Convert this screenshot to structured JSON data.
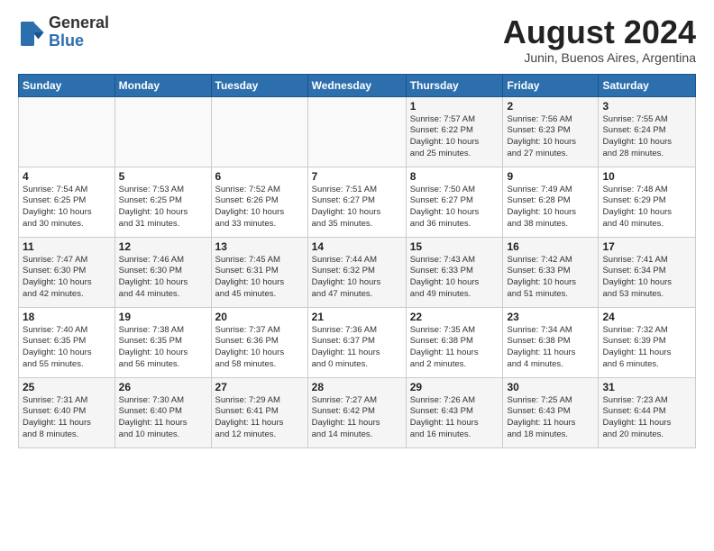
{
  "logo": {
    "line1": "General",
    "line2": "Blue"
  },
  "header": {
    "month_year": "August 2024",
    "location": "Junin, Buenos Aires, Argentina"
  },
  "days_of_week": [
    "Sunday",
    "Monday",
    "Tuesday",
    "Wednesday",
    "Thursday",
    "Friday",
    "Saturday"
  ],
  "weeks": [
    [
      {
        "day": "",
        "info": ""
      },
      {
        "day": "",
        "info": ""
      },
      {
        "day": "",
        "info": ""
      },
      {
        "day": "",
        "info": ""
      },
      {
        "day": "1",
        "info": "Sunrise: 7:57 AM\nSunset: 6:22 PM\nDaylight: 10 hours\nand 25 minutes."
      },
      {
        "day": "2",
        "info": "Sunrise: 7:56 AM\nSunset: 6:23 PM\nDaylight: 10 hours\nand 27 minutes."
      },
      {
        "day": "3",
        "info": "Sunrise: 7:55 AM\nSunset: 6:24 PM\nDaylight: 10 hours\nand 28 minutes."
      }
    ],
    [
      {
        "day": "4",
        "info": "Sunrise: 7:54 AM\nSunset: 6:25 PM\nDaylight: 10 hours\nand 30 minutes."
      },
      {
        "day": "5",
        "info": "Sunrise: 7:53 AM\nSunset: 6:25 PM\nDaylight: 10 hours\nand 31 minutes."
      },
      {
        "day": "6",
        "info": "Sunrise: 7:52 AM\nSunset: 6:26 PM\nDaylight: 10 hours\nand 33 minutes."
      },
      {
        "day": "7",
        "info": "Sunrise: 7:51 AM\nSunset: 6:27 PM\nDaylight: 10 hours\nand 35 minutes."
      },
      {
        "day": "8",
        "info": "Sunrise: 7:50 AM\nSunset: 6:27 PM\nDaylight: 10 hours\nand 36 minutes."
      },
      {
        "day": "9",
        "info": "Sunrise: 7:49 AM\nSunset: 6:28 PM\nDaylight: 10 hours\nand 38 minutes."
      },
      {
        "day": "10",
        "info": "Sunrise: 7:48 AM\nSunset: 6:29 PM\nDaylight: 10 hours\nand 40 minutes."
      }
    ],
    [
      {
        "day": "11",
        "info": "Sunrise: 7:47 AM\nSunset: 6:30 PM\nDaylight: 10 hours\nand 42 minutes."
      },
      {
        "day": "12",
        "info": "Sunrise: 7:46 AM\nSunset: 6:30 PM\nDaylight: 10 hours\nand 44 minutes."
      },
      {
        "day": "13",
        "info": "Sunrise: 7:45 AM\nSunset: 6:31 PM\nDaylight: 10 hours\nand 45 minutes."
      },
      {
        "day": "14",
        "info": "Sunrise: 7:44 AM\nSunset: 6:32 PM\nDaylight: 10 hours\nand 47 minutes."
      },
      {
        "day": "15",
        "info": "Sunrise: 7:43 AM\nSunset: 6:33 PM\nDaylight: 10 hours\nand 49 minutes."
      },
      {
        "day": "16",
        "info": "Sunrise: 7:42 AM\nSunset: 6:33 PM\nDaylight: 10 hours\nand 51 minutes."
      },
      {
        "day": "17",
        "info": "Sunrise: 7:41 AM\nSunset: 6:34 PM\nDaylight: 10 hours\nand 53 minutes."
      }
    ],
    [
      {
        "day": "18",
        "info": "Sunrise: 7:40 AM\nSunset: 6:35 PM\nDaylight: 10 hours\nand 55 minutes."
      },
      {
        "day": "19",
        "info": "Sunrise: 7:38 AM\nSunset: 6:35 PM\nDaylight: 10 hours\nand 56 minutes."
      },
      {
        "day": "20",
        "info": "Sunrise: 7:37 AM\nSunset: 6:36 PM\nDaylight: 10 hours\nand 58 minutes."
      },
      {
        "day": "21",
        "info": "Sunrise: 7:36 AM\nSunset: 6:37 PM\nDaylight: 11 hours\nand 0 minutes."
      },
      {
        "day": "22",
        "info": "Sunrise: 7:35 AM\nSunset: 6:38 PM\nDaylight: 11 hours\nand 2 minutes."
      },
      {
        "day": "23",
        "info": "Sunrise: 7:34 AM\nSunset: 6:38 PM\nDaylight: 11 hours\nand 4 minutes."
      },
      {
        "day": "24",
        "info": "Sunrise: 7:32 AM\nSunset: 6:39 PM\nDaylight: 11 hours\nand 6 minutes."
      }
    ],
    [
      {
        "day": "25",
        "info": "Sunrise: 7:31 AM\nSunset: 6:40 PM\nDaylight: 11 hours\nand 8 minutes."
      },
      {
        "day": "26",
        "info": "Sunrise: 7:30 AM\nSunset: 6:40 PM\nDaylight: 11 hours\nand 10 minutes."
      },
      {
        "day": "27",
        "info": "Sunrise: 7:29 AM\nSunset: 6:41 PM\nDaylight: 11 hours\nand 12 minutes."
      },
      {
        "day": "28",
        "info": "Sunrise: 7:27 AM\nSunset: 6:42 PM\nDaylight: 11 hours\nand 14 minutes."
      },
      {
        "day": "29",
        "info": "Sunrise: 7:26 AM\nSunset: 6:43 PM\nDaylight: 11 hours\nand 16 minutes."
      },
      {
        "day": "30",
        "info": "Sunrise: 7:25 AM\nSunset: 6:43 PM\nDaylight: 11 hours\nand 18 minutes."
      },
      {
        "day": "31",
        "info": "Sunrise: 7:23 AM\nSunset: 6:44 PM\nDaylight: 11 hours\nand 20 minutes."
      }
    ]
  ]
}
